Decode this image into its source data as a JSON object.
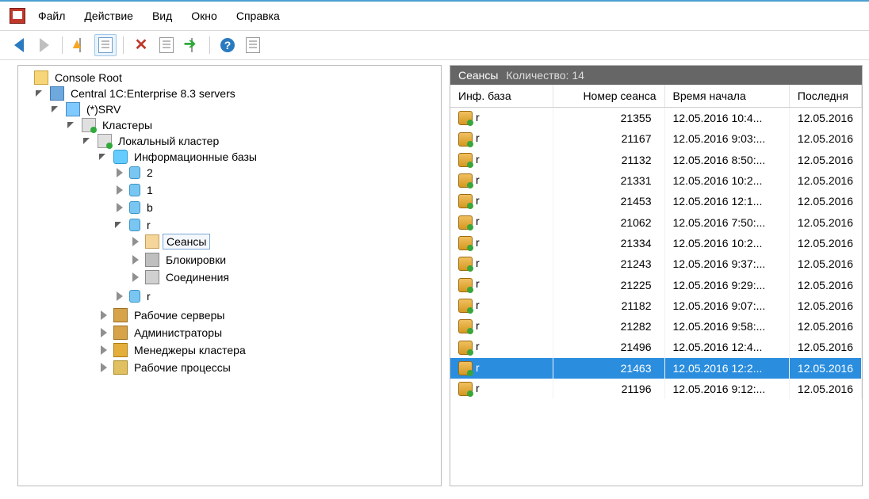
{
  "menu": {
    "items": [
      "Файл",
      "Действие",
      "Вид",
      "Окно",
      "Справка"
    ]
  },
  "toolbar": {
    "back": "Назад",
    "forward": "Вперёд"
  },
  "tree": {
    "root": "Console Root",
    "central": "Central 1C:Enterprise 8.3 servers",
    "host": "(*)SRV",
    "clusters": "Кластеры",
    "local_cluster": "Локальный кластер",
    "infobases": "Информационные базы",
    "db_items": [
      "2",
      "1",
      "b",
      "r",
      "r"
    ],
    "sessions": "Сеансы",
    "locks": "Блокировки",
    "connections": "Соединения",
    "work_servers": "Рабочие серверы",
    "admins": "Администраторы",
    "cluster_mgrs": "Менеджеры кластера",
    "work_procs": "Рабочие процессы"
  },
  "list": {
    "title": "Сеансы",
    "count_label": "Количество: 14",
    "cols": {
      "infobase": "Инф. база",
      "session_no": "Номер сеанса",
      "start_time": "Время начала",
      "last": "Последня"
    },
    "rows": [
      {
        "ib": "r",
        "no": "21355",
        "start": "12.05.2016 10:4...",
        "last": "12.05.2016"
      },
      {
        "ib": "r",
        "no": "21167",
        "start": "12.05.2016 9:03:...",
        "last": "12.05.2016"
      },
      {
        "ib": "r",
        "no": "21132",
        "start": "12.05.2016 8:50:...",
        "last": "12.05.2016"
      },
      {
        "ib": "r",
        "no": "21331",
        "start": "12.05.2016 10:2...",
        "last": "12.05.2016"
      },
      {
        "ib": "r",
        "no": "21453",
        "start": "12.05.2016 12:1...",
        "last": "12.05.2016"
      },
      {
        "ib": "r",
        "no": "21062",
        "start": "12.05.2016 7:50:...",
        "last": "12.05.2016"
      },
      {
        "ib": "r",
        "no": "21334",
        "start": "12.05.2016 10:2...",
        "last": "12.05.2016"
      },
      {
        "ib": "r",
        "no": "21243",
        "start": "12.05.2016 9:37:...",
        "last": "12.05.2016"
      },
      {
        "ib": "r",
        "no": "21225",
        "start": "12.05.2016 9:29:...",
        "last": "12.05.2016"
      },
      {
        "ib": "r",
        "no": "21182",
        "start": "12.05.2016 9:07:...",
        "last": "12.05.2016"
      },
      {
        "ib": "r",
        "no": "21282",
        "start": "12.05.2016 9:58:...",
        "last": "12.05.2016"
      },
      {
        "ib": "r",
        "no": "21496",
        "start": "12.05.2016 12:4...",
        "last": "12.05.2016"
      },
      {
        "ib": "r",
        "no": "21463",
        "start": "12.05.2016 12:2...",
        "last": "12.05.2016",
        "selected": true
      },
      {
        "ib": "r",
        "no": "21196",
        "start": "12.05.2016 9:12:...",
        "last": "12.05.2016"
      }
    ]
  }
}
